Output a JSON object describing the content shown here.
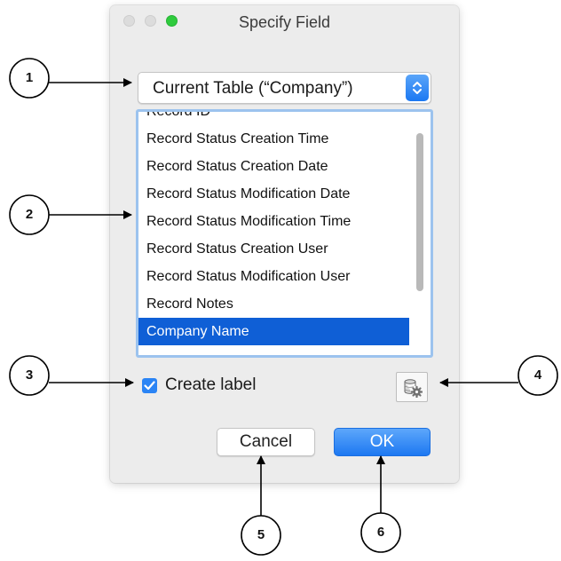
{
  "dialog": {
    "title": "Specify Field",
    "table_popup": {
      "selected": "Current Table (“Company”)"
    },
    "field_list": {
      "items": [
        {
          "label": "Record ID",
          "selected": false
        },
        {
          "label": "Record Status Creation Time",
          "selected": false
        },
        {
          "label": "Record Status Creation Date",
          "selected": false
        },
        {
          "label": "Record Status Modification Date",
          "selected": false
        },
        {
          "label": "Record Status Modification Time",
          "selected": false
        },
        {
          "label": "Record Status Creation User",
          "selected": false
        },
        {
          "label": "Record Status Modification User",
          "selected": false
        },
        {
          "label": "Record Notes",
          "selected": false
        },
        {
          "label": "Company Name",
          "selected": true
        }
      ]
    },
    "create_label": {
      "label": "Create label",
      "checked": true
    },
    "buttons": {
      "cancel": "Cancel",
      "ok": "OK"
    }
  },
  "annotations": {
    "markers": [
      "1",
      "2",
      "3",
      "4",
      "5",
      "6"
    ]
  },
  "colors": {
    "selection": "#0f5fd6",
    "accent_blue": "#2a84f5",
    "list_focus_ring": "#9cc3ee",
    "window_background": "#ececec"
  },
  "icons": [
    "popup-chevrons-icon",
    "checkmark-icon",
    "database-gear-icon"
  ]
}
